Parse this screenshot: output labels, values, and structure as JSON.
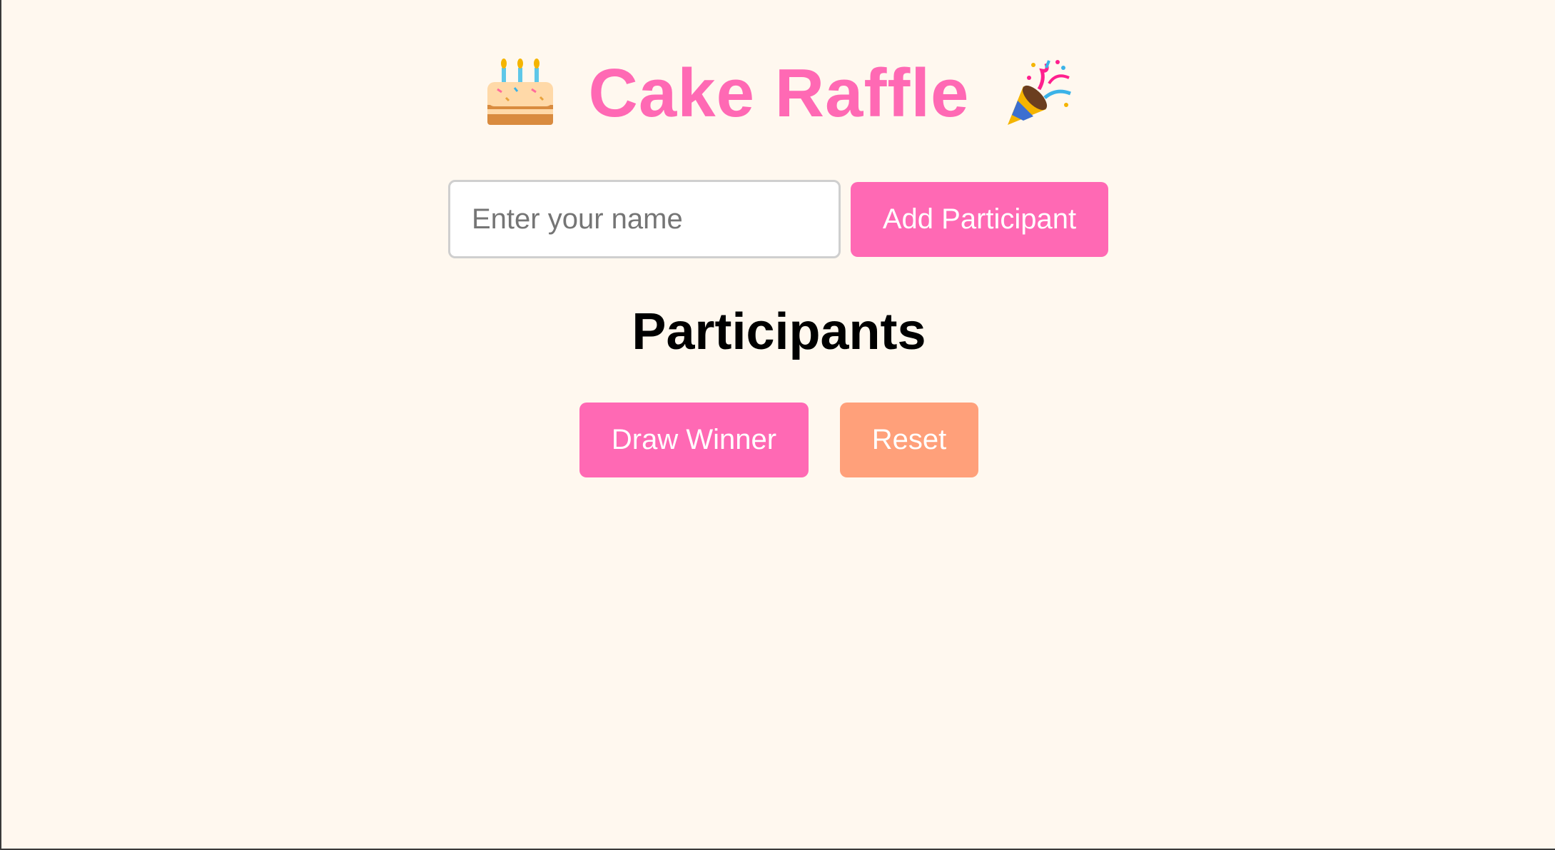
{
  "header": {
    "title": "Cake Raffle",
    "left_icon": "birthday-cake-icon",
    "right_icon": "party-popper-icon"
  },
  "entry": {
    "name_placeholder": "Enter your name",
    "name_value": "",
    "add_button_label": "Add Participant"
  },
  "participants": {
    "heading": "Participants",
    "items": []
  },
  "actions": {
    "draw_label": "Draw Winner",
    "reset_label": "Reset"
  },
  "colors": {
    "background": "#fff8ef",
    "accent_pink": "#ff69b4",
    "reset_salmon": "#ffa07a"
  }
}
